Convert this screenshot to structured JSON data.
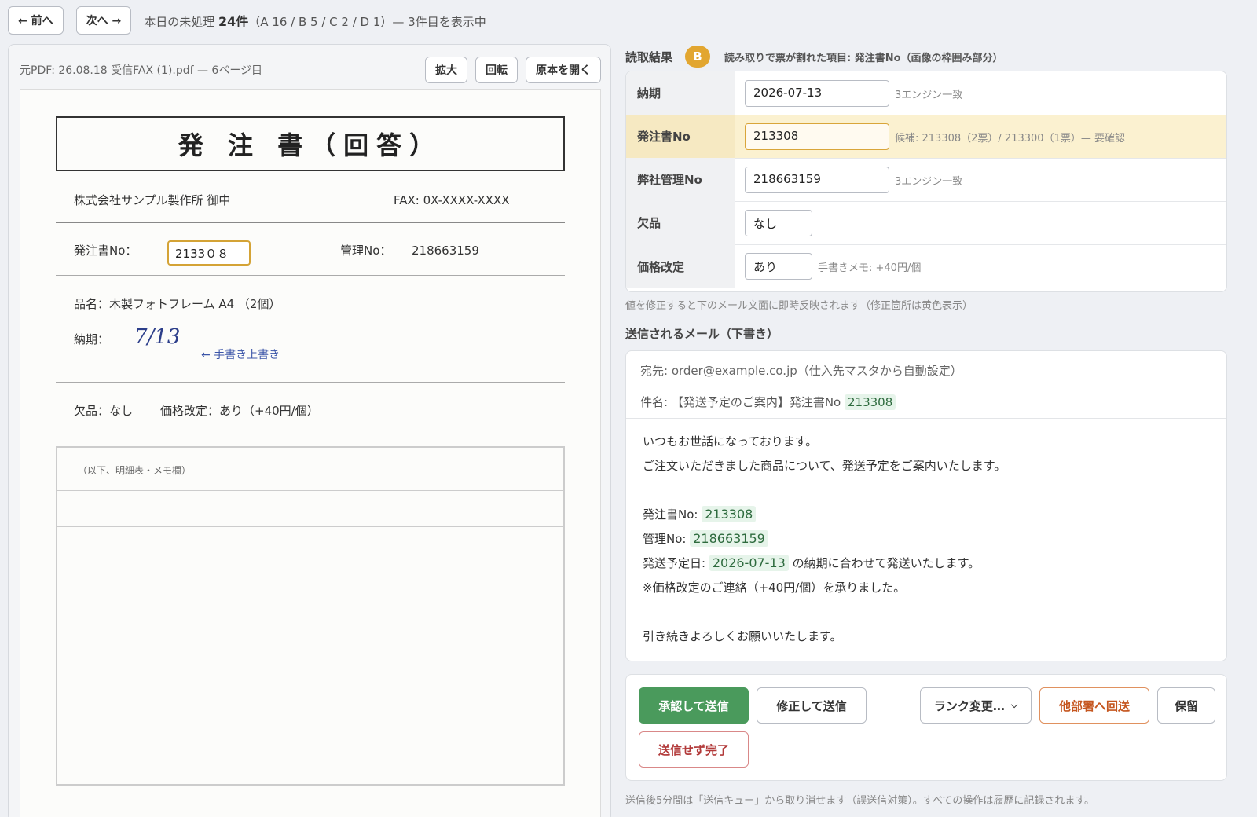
{
  "nav": {
    "prev_label": "← 前へ",
    "next_label": "次へ →",
    "queue_prefix": "本日の未処理 ",
    "queue_count": "24件",
    "queue_suffix": "（A 16 / B 5 / C 2 / D 1）— 3件目を表示中"
  },
  "viewer": {
    "source_label": "元PDF: 26.08.18 受信FAX (1).pdf — 6ページ目",
    "zoom_label": "拡大",
    "rotate_label": "回転",
    "open_label": "原本を開く"
  },
  "document": {
    "title": "発 注 書（回答）",
    "recipient": "株式会社サンプル製作所 御中",
    "fax": "FAX: 0X-XXXX-XXXX",
    "po_label": "発注書No：",
    "po_value": "2133０８",
    "mgmt_label": "管理No：",
    "mgmt_value": "218663159",
    "item": "品名：木製フォトフレーム A4 （2個）",
    "due_label": "納期：",
    "due_handwritten": "7/13",
    "handwritten_note": "← 手書き上書き",
    "shortage": "欠品：なし",
    "price_change": "価格改定：あり（+40円/個）",
    "table_note": "（以下、明細表・メモ欄）"
  },
  "reading": {
    "title": "読取結果",
    "rank": "B",
    "split_note": "読み取りで票が割れた項目: 発注書No（画像の枠囲み部分）",
    "fields": [
      {
        "label": "納期",
        "value": "2026-07-13",
        "note": "3エンジン一致"
      },
      {
        "label": "発注書No",
        "value": "213308",
        "note": "候補: 213308（2票）/ 213300（1票）— 要確認"
      },
      {
        "label": "弊社管理No",
        "value": "218663159",
        "note": "3エンジン一致"
      },
      {
        "label": "欠品",
        "value": "なし",
        "note": ""
      },
      {
        "label": "価格改定",
        "value": "あり",
        "note": "手書きメモ: +40円/個"
      }
    ],
    "reflect_note": "値を修正すると下のメール文面に即時反映されます（修正箇所は黄色表示）"
  },
  "mail": {
    "title": "送信されるメール（下書き）",
    "to": "宛先: order@example.co.jp（仕入先マスタから自動設定）",
    "subject_prefix": "件名: 【発送予定のご案内】発注書No ",
    "subject_po": "213308",
    "greeting": "いつもお世話になっております。",
    "intro": "ご注文いただきました商品について、発送予定をご案内いたします。",
    "po_prefix": "発注書No: ",
    "po_value": "213308",
    "mgmt_prefix": "管理No: ",
    "mgmt_value": "218663159",
    "ship_prefix": "発送予定日: ",
    "ship_date": "2026-07-13",
    "ship_suffix": " の納期に合わせて発送いたします。",
    "price_note": "※価格改定のご連絡（+40円/個）を承りました。",
    "closing": "引き続きよろしくお願いいたします。"
  },
  "actions": {
    "approve": "承認して送信",
    "fix": "修正して送信",
    "rank_change": "ランク変更…",
    "other_dept": "他部署へ回送",
    "hold": "保留",
    "no_send": "送信せず完了"
  },
  "footer_note": "送信後5分間は「送信キュー」から取り消せます（誤送信対策）。すべての操作は履歴に記録されます。",
  "colors": {
    "approve": "#4a9a5c",
    "rank_badge": "#e2a630",
    "warn_row": "#fbf1d0",
    "highlight": "#e6f4ea"
  }
}
